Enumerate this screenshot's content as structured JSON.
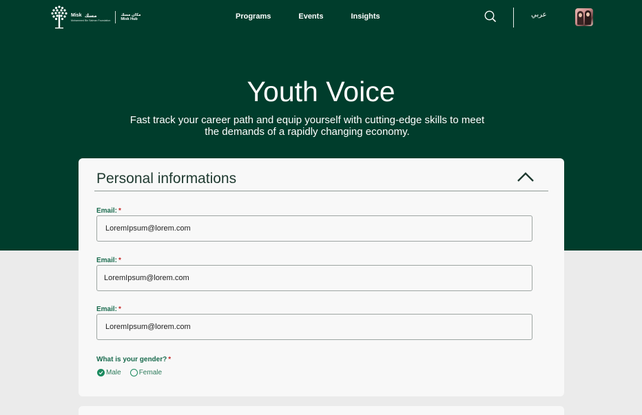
{
  "brand": {
    "name": "Misk",
    "name_ar": "مسك",
    "tagline": "Mohammed Bin Salman Foundation",
    "hub_ar": "مكان مسك",
    "hub_en": "Misk Hub"
  },
  "nav": {
    "links": [
      "Programs",
      "Events",
      "Insights"
    ],
    "language": "عربي"
  },
  "hero": {
    "title": "Youth Voice",
    "subtitle": "Fast track your career path and equip yourself with cutting-edge skills to meet the demands of a rapidly changing economy."
  },
  "form": {
    "section_title": "Personal informations",
    "fields": [
      {
        "label": "Email:",
        "required_mark": "*",
        "value": "LoremIpsum@lorem.com"
      },
      {
        "label": "Email:",
        "required_mark": "*",
        "value": "LoremIpsum@lorem.com"
      },
      {
        "label": "Email:",
        "required_mark": "*",
        "value": "LoremIpsum@lorem.com"
      }
    ],
    "gender": {
      "question": "What is your gender?",
      "required_mark": "*",
      "options": [
        "Male",
        "Female"
      ],
      "selected": "Male"
    }
  },
  "colors": {
    "hero_bg": "#003d2c",
    "accent": "#1a8a5e",
    "label": "#1a6b4e",
    "required": "#c62828"
  },
  "icons": [
    "misk-tree-logo-icon",
    "search-icon",
    "chevron-up-icon",
    "check-icon"
  ]
}
